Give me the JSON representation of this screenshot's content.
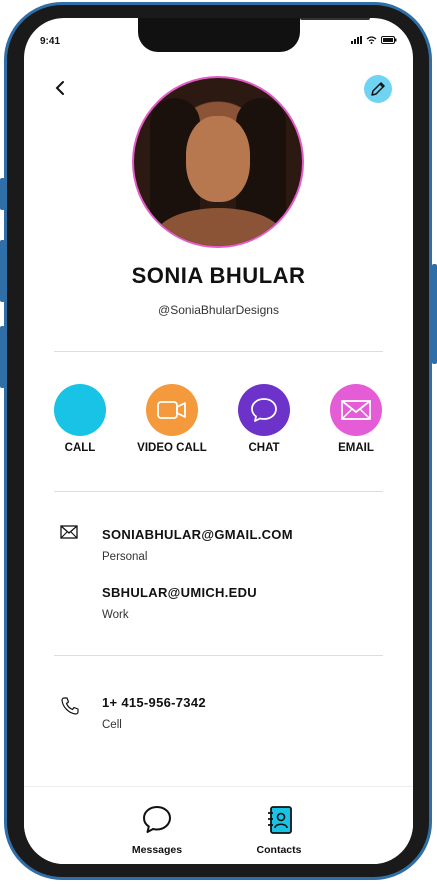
{
  "status": {
    "time": "9:41",
    "icons": [
      "signal-icon",
      "wifi-icon",
      "battery-icon"
    ]
  },
  "contact": {
    "name": "SONIA BHULAR",
    "handle": "@SoniaBhularDesigns"
  },
  "actions": [
    {
      "label": "CALL",
      "color": "#18c3e6",
      "icon": "phone-icon"
    },
    {
      "label": "VIDEO CALL",
      "color": "#f49a3d",
      "icon": "video-icon"
    },
    {
      "label": "CHAT",
      "color": "#6c32c9",
      "icon": "chat-icon"
    },
    {
      "label": "EMAIL",
      "color": "#e45cd6",
      "icon": "email-icon"
    }
  ],
  "emails": [
    {
      "value": "SONIABHULAR@GMAIL.COM",
      "type": "Personal"
    },
    {
      "value": "SBHULAR@UMICH.EDU",
      "type": "Work"
    }
  ],
  "phones": [
    {
      "value": "1+ 415-956-7342",
      "type": "Cell"
    }
  ],
  "nav": {
    "messages_label": "Messages",
    "contacts_label": "Contacts"
  },
  "colors": {
    "frame": "#2f6ea6",
    "edit_button": "#6fd3f2",
    "avatar_ring": "#e45cc7"
  }
}
